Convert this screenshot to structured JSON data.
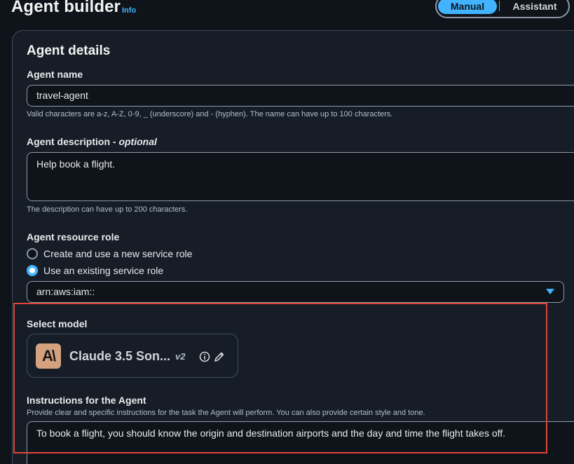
{
  "header": {
    "title": "Agent builder",
    "info_link": "Info",
    "mode_toggle": {
      "manual": "Manual",
      "assistant": "Assistant",
      "selected": "Manual"
    }
  },
  "agent_details": {
    "heading": "Agent details",
    "name": {
      "label": "Agent name",
      "value": "travel-agent",
      "hint": "Valid characters are a-z, A-Z, 0-9, _ (underscore) and - (hyphen). The name can have up to 100 characters."
    },
    "description": {
      "label": "Agent description - ",
      "optional": "optional",
      "value": "Help book a flight.",
      "hint": "The description can have up to 200 characters."
    },
    "resource_role": {
      "label": "Agent resource role",
      "options": [
        {
          "label": "Create and use a new service role",
          "checked": false
        },
        {
          "label": "Use an existing service role",
          "checked": true
        }
      ],
      "selected_role": "arn:aws:iam::"
    },
    "model": {
      "label": "Select model",
      "logo_text": "A\\",
      "name": "Claude 3.5 Son...",
      "version": "v2",
      "icons": [
        "info-icon",
        "pencil-icon"
      ]
    },
    "instructions": {
      "label": "Instructions for the Agent",
      "hint": "Provide clear and specific instructions for the task the Agent will perform. You can also provide certain style and tone.",
      "value": "To book a flight, you should know the origin and destination airports and the day and time the flight takes off."
    }
  },
  "colors": {
    "accent": "#42b4ff",
    "highlight_border": "#e0453a",
    "background": "#0f141a",
    "panel": "#161d26"
  }
}
